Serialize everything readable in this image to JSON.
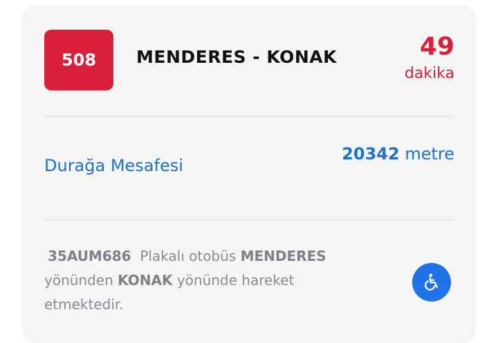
{
  "route": {
    "number": "508",
    "name": "MENDERES - KONAK"
  },
  "eta": {
    "value": "49",
    "unit": "dakika"
  },
  "distance": {
    "label": "Durağa Mesafesi",
    "value": "20342",
    "unit": "metre"
  },
  "info": {
    "plate": "35AUM686",
    "text1": "Plakalı otobüs",
    "from": "MENDERES",
    "text2": "yönünden",
    "to": "KONAK",
    "text3": "yönünde hareket etmektedir."
  },
  "accessibility": {
    "icon": "wheelchair-icon"
  },
  "colors": {
    "accent_red": "#d91f3a",
    "link_blue": "#1e73c8",
    "button_blue": "#1e73e8"
  }
}
